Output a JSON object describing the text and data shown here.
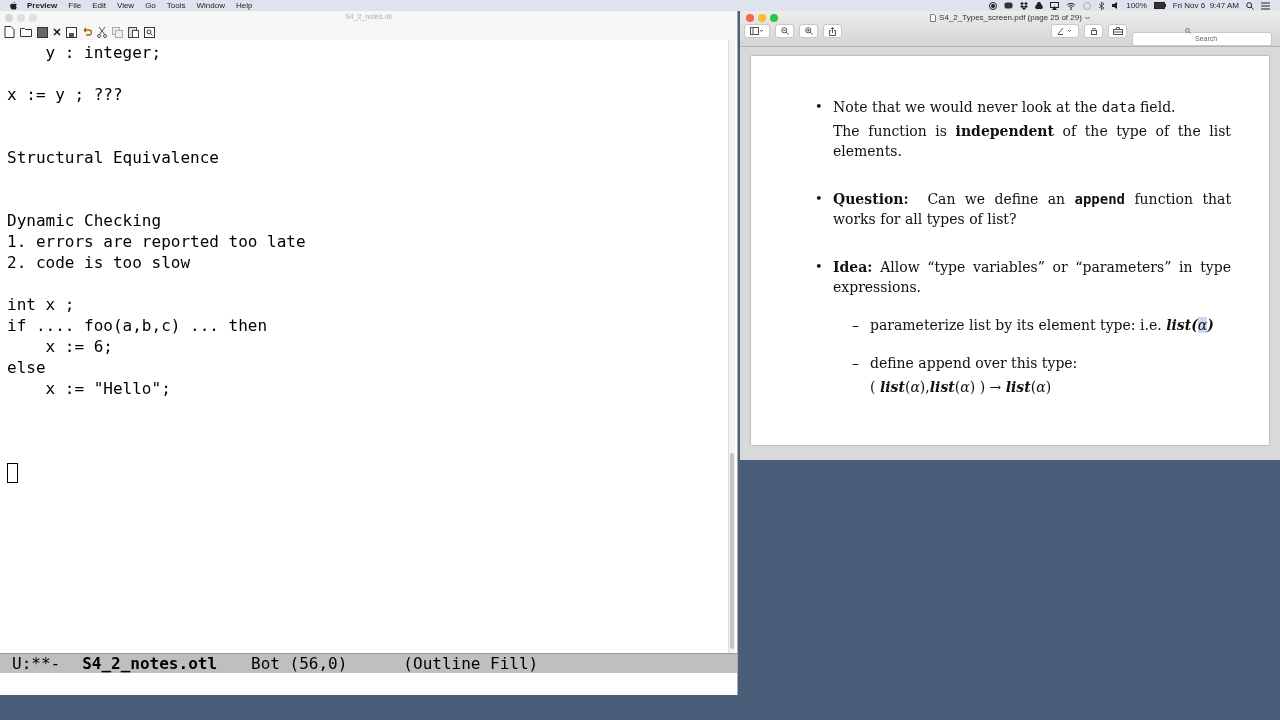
{
  "menu_bar": {
    "app": "Preview",
    "items": [
      "File",
      "Edit",
      "View",
      "Go",
      "Tools",
      "Window",
      "Help"
    ],
    "battery": "100%",
    "clock": "Fri Nov 6  9:47 AM"
  },
  "editor": {
    "title": "S4_2_notes.otl",
    "lines": [
      {
        "kind": "text",
        "text": "    y : integer;"
      },
      {
        "kind": "blank"
      },
      {
        "kind": "text",
        "text": "x := y ; ???"
      },
      {
        "kind": "blank"
      },
      {
        "kind": "blank"
      },
      {
        "kind": "text",
        "text": "Structural Equivalence"
      },
      {
        "kind": "blank"
      },
      {
        "kind": "blank"
      },
      {
        "kind": "text",
        "text": "Dynamic Checking"
      },
      {
        "kind": "text",
        "text": "1. errors are reported too late"
      },
      {
        "kind": "text",
        "text": "2. code is too slow"
      },
      {
        "kind": "blank"
      },
      {
        "kind": "text",
        "text": "int x ;"
      },
      {
        "kind": "text",
        "text": "if .... foo(a,b,c) ... then"
      },
      {
        "kind": "text",
        "text": "    x := 6;"
      },
      {
        "kind": "text",
        "text": "else"
      },
      {
        "kind": "text",
        "text": "    x := \"Hello\";"
      },
      {
        "kind": "blank"
      },
      {
        "kind": "blank"
      },
      {
        "kind": "blank"
      },
      {
        "kind": "cursor"
      }
    ],
    "mode_line": {
      "state": "U:**-",
      "buffer": "S4_2_notes.otl",
      "position": "Bot (56,0)",
      "modes": "(Outline Fill)"
    }
  },
  "viewer": {
    "title": "S4_2_Types_screen.pdf (page 25 of 29)",
    "search": {
      "placeholder": "Search"
    },
    "items": [
      {
        "marker": "•",
        "kind": "bullet",
        "paragraphs": [
          [
            {
              "kind": "roman",
              "text": "Note that we would never look at the "
            },
            {
              "kind": "tt",
              "text": "data"
            },
            {
              "kind": "roman",
              "text": " field."
            }
          ],
          [
            {
              "kind": "roman",
              "text": "The function is "
            },
            {
              "kind": "bold",
              "text": "independent"
            },
            {
              "kind": "roman",
              "text": " of the type of the list elements."
            }
          ]
        ]
      },
      {
        "marker": "•",
        "kind": "bullet",
        "paragraphs": [
          [
            {
              "kind": "bold",
              "text": "Question:"
            },
            {
              "kind": "roman",
              "text": "  Can we define an "
            },
            {
              "kind": "ttbold",
              "text": "append"
            },
            {
              "kind": "roman",
              "text": " function that works for all types of list?"
            }
          ]
        ]
      },
      {
        "marker": "•",
        "kind": "bullet",
        "paragraphs": [
          [
            {
              "kind": "bold",
              "text": "Idea:"
            },
            {
              "kind": "roman",
              "text": " Allow “type variables” or “parameters” in type expressions."
            }
          ]
        ]
      },
      {
        "marker": "–",
        "kind": "dash",
        "paragraphs": [
          [
            {
              "kind": "roman",
              "text": "parameterize list by its element type: i.e. "
            },
            {
              "kind": "bolditalic",
              "text": "list("
            },
            {
              "kind": "italic",
              "text": "α",
              "highlighted": true
            },
            {
              "kind": "bolditalic",
              "text": ")"
            }
          ]
        ]
      },
      {
        "marker": "–",
        "kind": "dash",
        "paragraphs": [
          [
            {
              "kind": "roman",
              "text": "define append over this type:"
            }
          ],
          [
            {
              "kind": "roman",
              "text": "( "
            },
            {
              "kind": "bolditalic",
              "text": "list"
            },
            {
              "kind": "roman",
              "text": "("
            },
            {
              "kind": "italic",
              "text": "α"
            },
            {
              "kind": "roman",
              "text": "),"
            },
            {
              "kind": "bolditalic",
              "text": "list"
            },
            {
              "kind": "roman",
              "text": "("
            },
            {
              "kind": "italic",
              "text": "α"
            },
            {
              "kind": "roman",
              "text": ") ) → "
            },
            {
              "kind": "bolditalic",
              "text": "list"
            },
            {
              "kind": "roman",
              "text": "("
            },
            {
              "kind": "italic",
              "text": "α"
            },
            {
              "kind": "roman",
              "text": ")"
            }
          ]
        ]
      }
    ]
  }
}
